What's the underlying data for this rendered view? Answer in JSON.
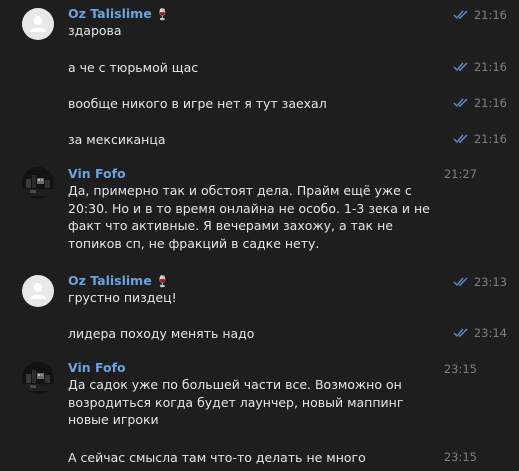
{
  "messages": [
    {
      "sender": "Oz Talislime",
      "wine_icon": "🍷",
      "text": "здарова",
      "time": "21:16",
      "read": true
    },
    {
      "text": "а че с тюрьмой щас",
      "time": "21:16",
      "read": true
    },
    {
      "text": "вообще никого в игре нет я тут заехал",
      "time": "21:16",
      "read": true
    },
    {
      "text": "за мексиканца",
      "time": "21:16",
      "read": true
    },
    {
      "sender": "Vin Fofo",
      "text": "Да, примерно так и обстоят дела. Прайм ещё уже с 20:30. Но и в то время онлайна не особо. 1-3 зека и не факт что активные. Я вечерами захожу, а так не топиков сп, не фракций в садке нету.",
      "time": "21:27"
    },
    {
      "sender": "Oz Talislime",
      "wine_icon": "🍷",
      "text": "грустно пиздец!",
      "time": "23:13",
      "read": true
    },
    {
      "text": "лидера походу менять надо",
      "time": "23:14",
      "read": true
    },
    {
      "sender": "Vin Fofo",
      "text": "Да садок уже по большей части все. Возможно он возродиться когда будет лаунчер, новый маппинг новые игроки",
      "time": "23:15"
    },
    {
      "text": "А сейчас смысла там что-то делать не много",
      "time": "23:15"
    }
  ],
  "colors": {
    "background": "#1e1e1e",
    "name": "#6aa3e0",
    "text": "#e6e6e6",
    "time": "#7e7e7e",
    "check": "#5a8fd0"
  }
}
